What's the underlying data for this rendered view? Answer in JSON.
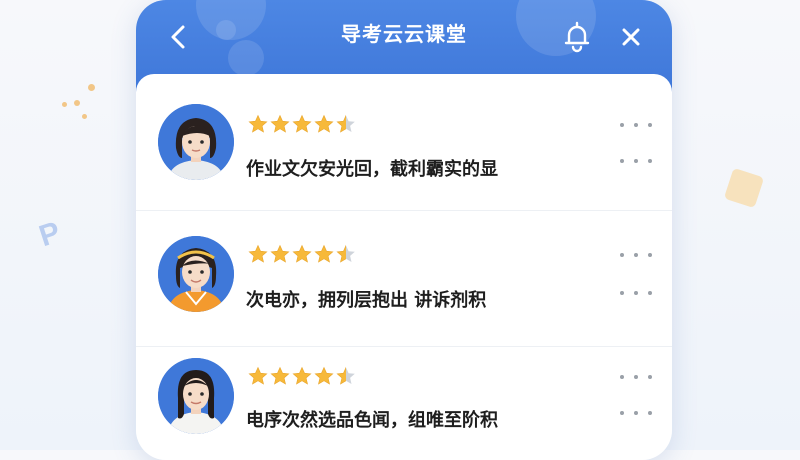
{
  "header": {
    "title": "导考云云课堂",
    "back_icon": "chevron-left-icon",
    "bell_icon": "bell-icon",
    "close_icon": "close-icon"
  },
  "reviews": [
    {
      "rating": 4.5,
      "text": "作业文欠安光回，截利霸实的显"
    },
    {
      "rating": 4.5,
      "text": "次电亦，拥列层抱出 讲诉剂积"
    },
    {
      "rating": 4.5,
      "text": "电序次然选品色闻，组唯至阶积"
    }
  ],
  "colors": {
    "header_blue": "#4680e0",
    "star_gold": "#f7b93a",
    "star_empty": "#cfd4db",
    "background": "#f4f6fa"
  }
}
